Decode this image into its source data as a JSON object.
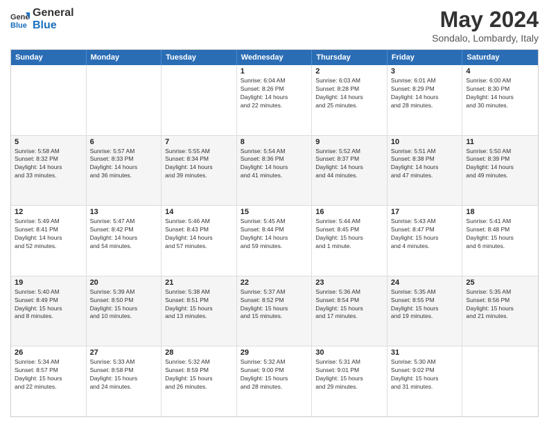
{
  "header": {
    "logo_general": "General",
    "logo_blue": "Blue",
    "title": "May 2024",
    "location": "Sondalo, Lombardy, Italy"
  },
  "calendar": {
    "days_of_week": [
      "Sunday",
      "Monday",
      "Tuesday",
      "Wednesday",
      "Thursday",
      "Friday",
      "Saturday"
    ],
    "rows": [
      {
        "alt": false,
        "cells": [
          {
            "day": "",
            "info": ""
          },
          {
            "day": "",
            "info": ""
          },
          {
            "day": "",
            "info": ""
          },
          {
            "day": "1",
            "info": "Sunrise: 6:04 AM\nSunset: 8:26 PM\nDaylight: 14 hours\nand 22 minutes."
          },
          {
            "day": "2",
            "info": "Sunrise: 6:03 AM\nSunset: 8:28 PM\nDaylight: 14 hours\nand 25 minutes."
          },
          {
            "day": "3",
            "info": "Sunrise: 6:01 AM\nSunset: 8:29 PM\nDaylight: 14 hours\nand 28 minutes."
          },
          {
            "day": "4",
            "info": "Sunrise: 6:00 AM\nSunset: 8:30 PM\nDaylight: 14 hours\nand 30 minutes."
          }
        ]
      },
      {
        "alt": true,
        "cells": [
          {
            "day": "5",
            "info": "Sunrise: 5:58 AM\nSunset: 8:32 PM\nDaylight: 14 hours\nand 33 minutes."
          },
          {
            "day": "6",
            "info": "Sunrise: 5:57 AM\nSunset: 8:33 PM\nDaylight: 14 hours\nand 36 minutes."
          },
          {
            "day": "7",
            "info": "Sunrise: 5:55 AM\nSunset: 8:34 PM\nDaylight: 14 hours\nand 39 minutes."
          },
          {
            "day": "8",
            "info": "Sunrise: 5:54 AM\nSunset: 8:36 PM\nDaylight: 14 hours\nand 41 minutes."
          },
          {
            "day": "9",
            "info": "Sunrise: 5:52 AM\nSunset: 8:37 PM\nDaylight: 14 hours\nand 44 minutes."
          },
          {
            "day": "10",
            "info": "Sunrise: 5:51 AM\nSunset: 8:38 PM\nDaylight: 14 hours\nand 47 minutes."
          },
          {
            "day": "11",
            "info": "Sunrise: 5:50 AM\nSunset: 8:39 PM\nDaylight: 14 hours\nand 49 minutes."
          }
        ]
      },
      {
        "alt": false,
        "cells": [
          {
            "day": "12",
            "info": "Sunrise: 5:49 AM\nSunset: 8:41 PM\nDaylight: 14 hours\nand 52 minutes."
          },
          {
            "day": "13",
            "info": "Sunrise: 5:47 AM\nSunset: 8:42 PM\nDaylight: 14 hours\nand 54 minutes."
          },
          {
            "day": "14",
            "info": "Sunrise: 5:46 AM\nSunset: 8:43 PM\nDaylight: 14 hours\nand 57 minutes."
          },
          {
            "day": "15",
            "info": "Sunrise: 5:45 AM\nSunset: 8:44 PM\nDaylight: 14 hours\nand 59 minutes."
          },
          {
            "day": "16",
            "info": "Sunrise: 5:44 AM\nSunset: 8:45 PM\nDaylight: 15 hours\nand 1 minute."
          },
          {
            "day": "17",
            "info": "Sunrise: 5:43 AM\nSunset: 8:47 PM\nDaylight: 15 hours\nand 4 minutes."
          },
          {
            "day": "18",
            "info": "Sunrise: 5:41 AM\nSunset: 8:48 PM\nDaylight: 15 hours\nand 6 minutes."
          }
        ]
      },
      {
        "alt": true,
        "cells": [
          {
            "day": "19",
            "info": "Sunrise: 5:40 AM\nSunset: 8:49 PM\nDaylight: 15 hours\nand 8 minutes."
          },
          {
            "day": "20",
            "info": "Sunrise: 5:39 AM\nSunset: 8:50 PM\nDaylight: 15 hours\nand 10 minutes."
          },
          {
            "day": "21",
            "info": "Sunrise: 5:38 AM\nSunset: 8:51 PM\nDaylight: 15 hours\nand 13 minutes."
          },
          {
            "day": "22",
            "info": "Sunrise: 5:37 AM\nSunset: 8:52 PM\nDaylight: 15 hours\nand 15 minutes."
          },
          {
            "day": "23",
            "info": "Sunrise: 5:36 AM\nSunset: 8:54 PM\nDaylight: 15 hours\nand 17 minutes."
          },
          {
            "day": "24",
            "info": "Sunrise: 5:35 AM\nSunset: 8:55 PM\nDaylight: 15 hours\nand 19 minutes."
          },
          {
            "day": "25",
            "info": "Sunrise: 5:35 AM\nSunset: 8:56 PM\nDaylight: 15 hours\nand 21 minutes."
          }
        ]
      },
      {
        "alt": false,
        "cells": [
          {
            "day": "26",
            "info": "Sunrise: 5:34 AM\nSunset: 8:57 PM\nDaylight: 15 hours\nand 22 minutes."
          },
          {
            "day": "27",
            "info": "Sunrise: 5:33 AM\nSunset: 8:58 PM\nDaylight: 15 hours\nand 24 minutes."
          },
          {
            "day": "28",
            "info": "Sunrise: 5:32 AM\nSunset: 8:59 PM\nDaylight: 15 hours\nand 26 minutes."
          },
          {
            "day": "29",
            "info": "Sunrise: 5:32 AM\nSunset: 9:00 PM\nDaylight: 15 hours\nand 28 minutes."
          },
          {
            "day": "30",
            "info": "Sunrise: 5:31 AM\nSunset: 9:01 PM\nDaylight: 15 hours\nand 29 minutes."
          },
          {
            "day": "31",
            "info": "Sunrise: 5:30 AM\nSunset: 9:02 PM\nDaylight: 15 hours\nand 31 minutes."
          },
          {
            "day": "",
            "info": ""
          }
        ]
      }
    ]
  }
}
